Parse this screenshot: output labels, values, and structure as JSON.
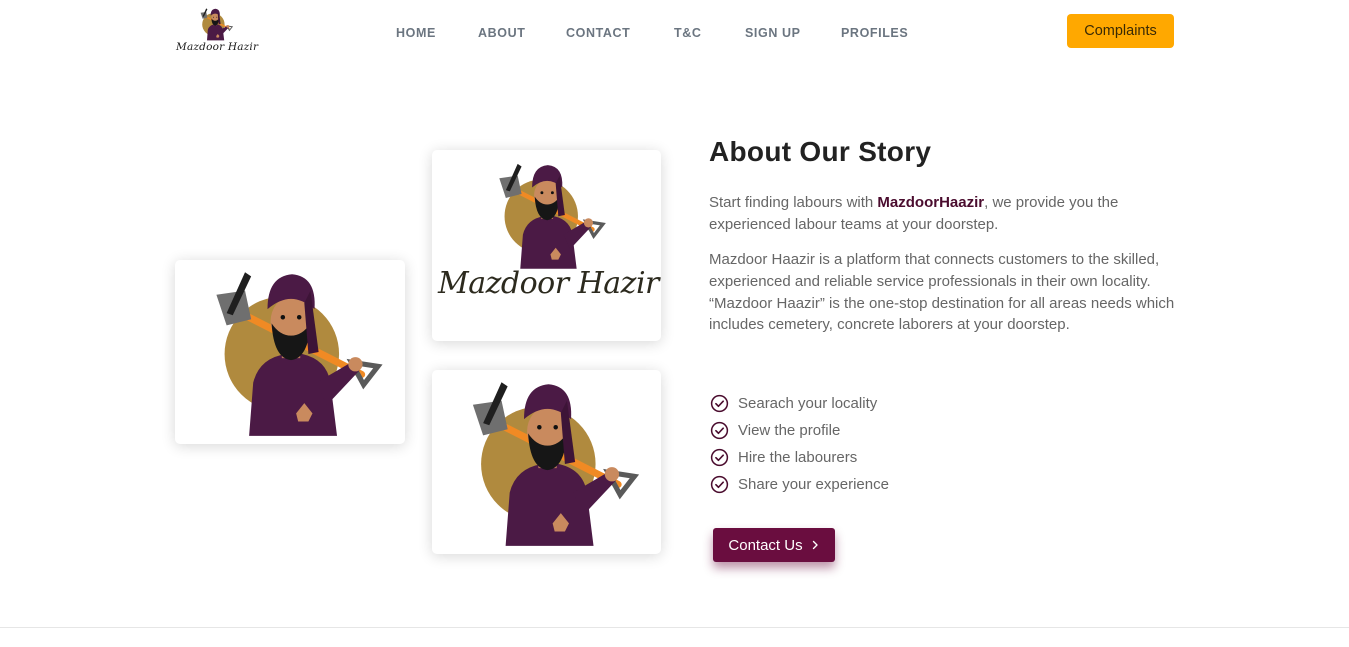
{
  "header": {
    "logo_text": "Mazdoor Hazir",
    "nav": [
      {
        "label": "HOME"
      },
      {
        "label": "ABOUT"
      },
      {
        "label": "CONTACT"
      },
      {
        "label": "T&C"
      },
      {
        "label": "SIGN UP"
      },
      {
        "label": "PROFILES"
      }
    ],
    "complaints_label": "Complaints"
  },
  "colors": {
    "accent": "#ffa800",
    "brand": "#6a0d3f",
    "brand_text": "#4a0c2e"
  },
  "cards": {
    "brand_text": "Mazdoor Hazir",
    "illustration": "labourer-with-pickaxe"
  },
  "about": {
    "title": "About Our Story",
    "intro_before": "Start finding labours with ",
    "intro_brand": "MazdoorHaazir",
    "intro_after": ", we provide you the experienced labour teams at your doorstep.",
    "description": "Mazdoor Haazir is a platform that connects customers to the skilled, experienced and reliable service professionals in their own locality. “Mazdoor Haazir” is the one-stop destination for all areas needs which includes cemetery, concrete laborers at your doorstep.",
    "features": [
      {
        "label": "Searach your locality",
        "icon": "check-circle-icon"
      },
      {
        "label": "View the profile",
        "icon": "check-circle-icon"
      },
      {
        "label": "Hire the labourers",
        "icon": "check-circle-icon"
      },
      {
        "label": "Share your experience",
        "icon": "check-circle-icon"
      }
    ],
    "contact_label": "Contact Us",
    "contact_icon": "chevron-right-icon"
  }
}
